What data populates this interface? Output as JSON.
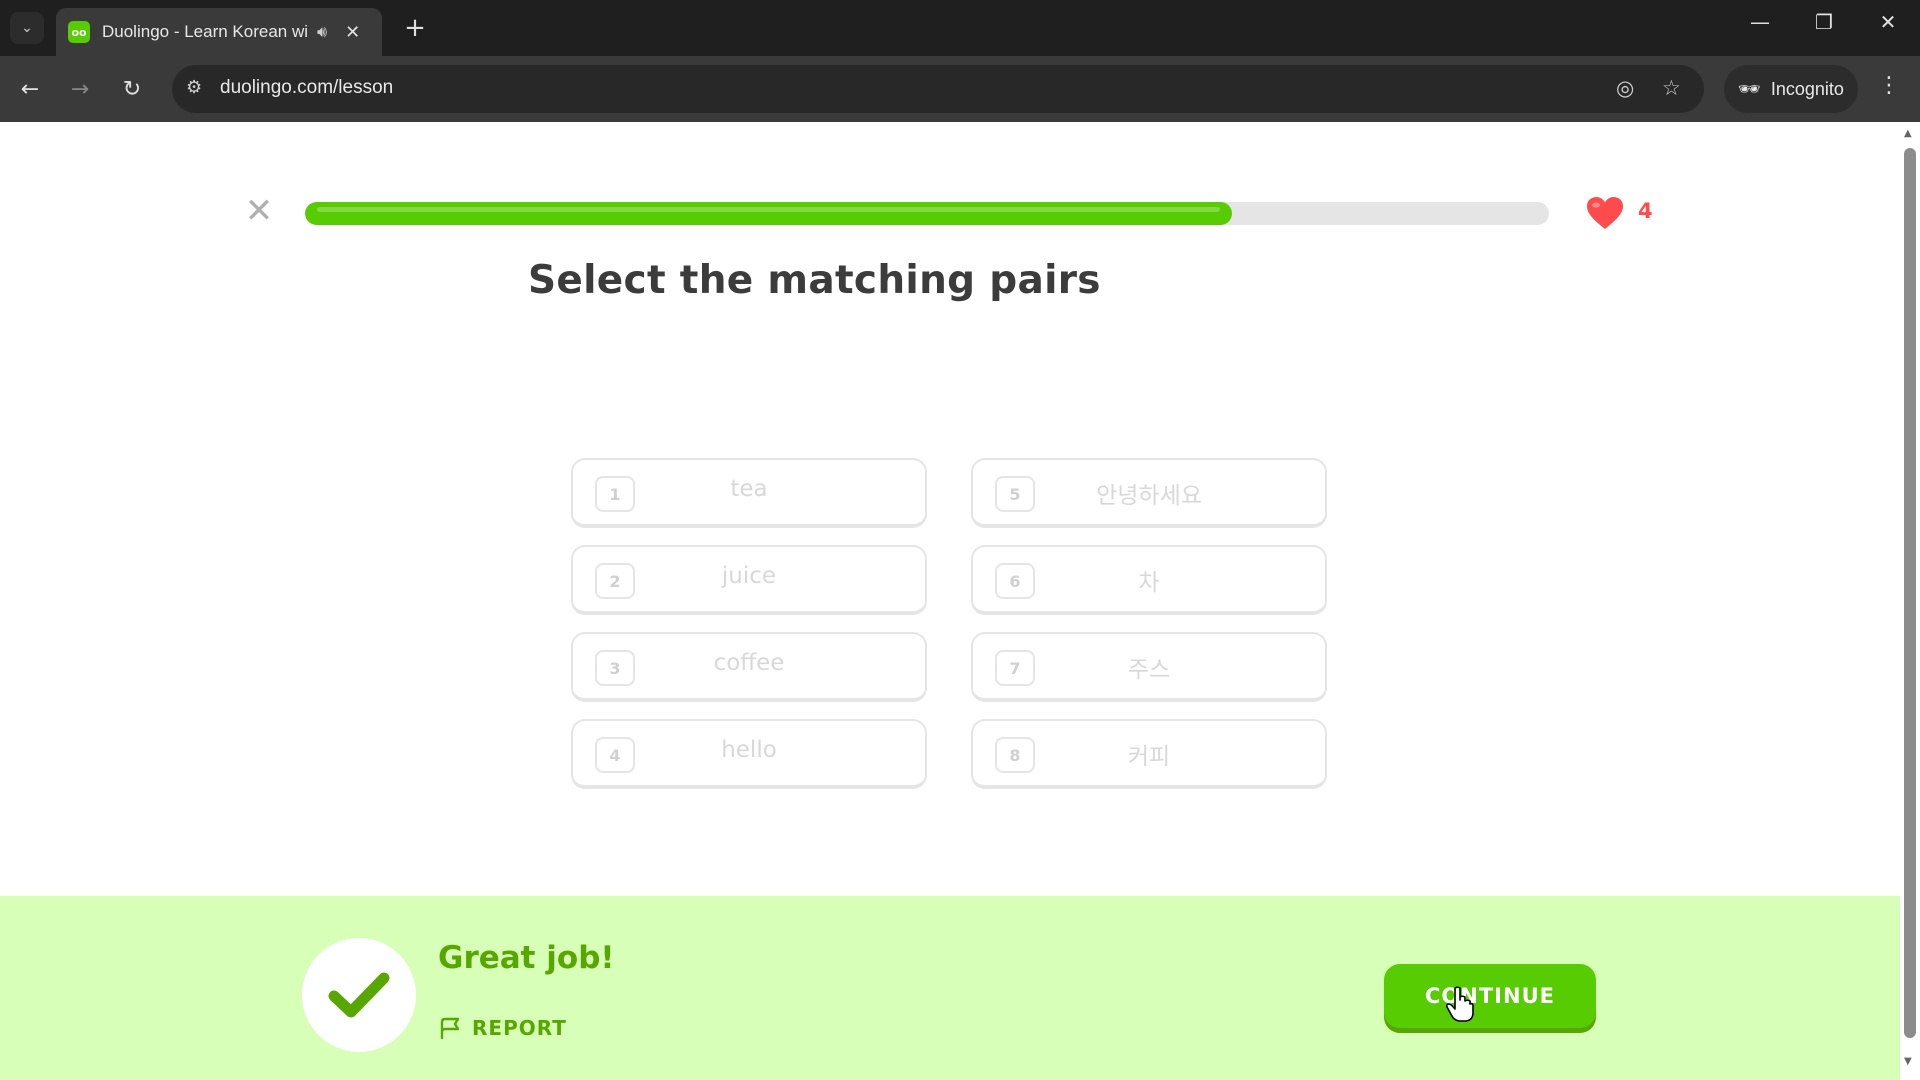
{
  "browser": {
    "tab_title": "Duolingo - Learn Korean wi",
    "favicon_text": "oo",
    "url": "duolingo.com/lesson",
    "incognito_label": "Incognito"
  },
  "lesson": {
    "progress_fraction": 0.745,
    "hearts": "4",
    "prompt": "Select the matching pairs",
    "left_pairs": [
      {
        "num": "1",
        "text": "tea"
      },
      {
        "num": "2",
        "text": "juice"
      },
      {
        "num": "3",
        "text": "coffee"
      },
      {
        "num": "4",
        "text": "hello"
      }
    ],
    "right_pairs": [
      {
        "num": "5",
        "text": "안녕하세요"
      },
      {
        "num": "6",
        "text": "차"
      },
      {
        "num": "7",
        "text": "주스"
      },
      {
        "num": "8",
        "text": "커피"
      }
    ]
  },
  "footer": {
    "feedback_title": "Great job!",
    "report_label": "REPORT",
    "continue_label": "CONTINUE"
  },
  "colors": {
    "brand_green": "#58cc02",
    "feedback_bg": "#d7ffb8",
    "feedback_text": "#58a700",
    "heart_red": "#ff4b4b"
  }
}
